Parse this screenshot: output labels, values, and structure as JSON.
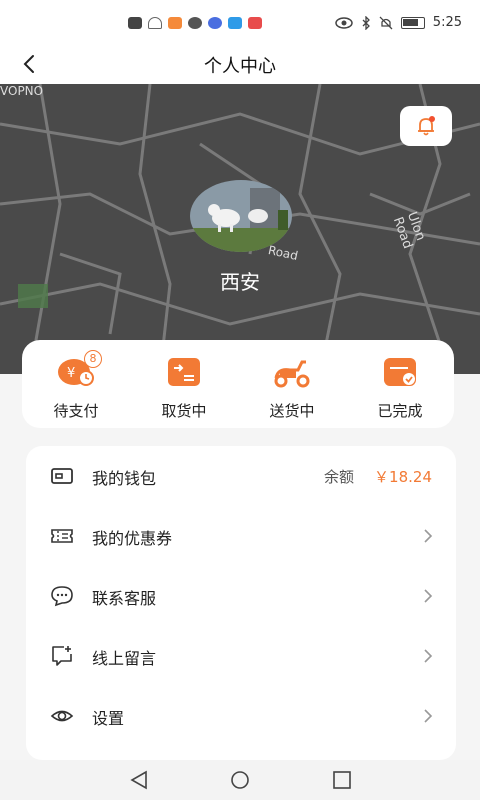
{
  "status_bar": {
    "time": "5:25"
  },
  "nav": {
    "title": "个人中心"
  },
  "map": {
    "labels": [
      "Ulon Road",
      "Road",
      "VOPNO"
    ]
  },
  "profile": {
    "city": "西安"
  },
  "orders": [
    {
      "label": "待支付",
      "icon": "wallet-yuan-clock-icon",
      "badge": "8"
    },
    {
      "label": "取货中",
      "icon": "pickup-icon"
    },
    {
      "label": "送货中",
      "icon": "scooter-icon"
    },
    {
      "label": "已完成",
      "icon": "completed-icon"
    }
  ],
  "menu": [
    {
      "label": "我的钱包",
      "icon": "wallet-icon",
      "balance_label": "余额",
      "balance_value": "￥18.24"
    },
    {
      "label": "我的优惠券",
      "icon": "coupon-icon"
    },
    {
      "label": "联系客服",
      "icon": "chat-icon"
    },
    {
      "label": "线上留言",
      "icon": "message-add-icon"
    },
    {
      "label": "设置",
      "icon": "eye-icon"
    }
  ],
  "colors": {
    "accent": "#f27a35",
    "map_bg": "#4a4a4a"
  }
}
